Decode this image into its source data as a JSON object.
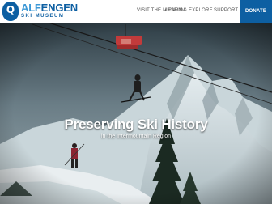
{
  "header": {
    "logo": {
      "line1_a": "ALF",
      "line1_b": "ENGEN",
      "line2": "SKI MUSEUM",
      "mark": "Q"
    },
    "nav": [
      {
        "label": "VISIT THE MUSEUM"
      },
      {
        "label": "LEARN & EXPLORE"
      },
      {
        "label": "SUPPORT"
      }
    ],
    "donate_label": "DONATE"
  },
  "hero": {
    "title": "Preserving Ski History",
    "subtitle": "in the Intermountain Region"
  },
  "colors": {
    "brand_blue": "#0d5fa2",
    "brand_light_blue": "#3c98d6",
    "nav_text": "#4d4d4d"
  }
}
